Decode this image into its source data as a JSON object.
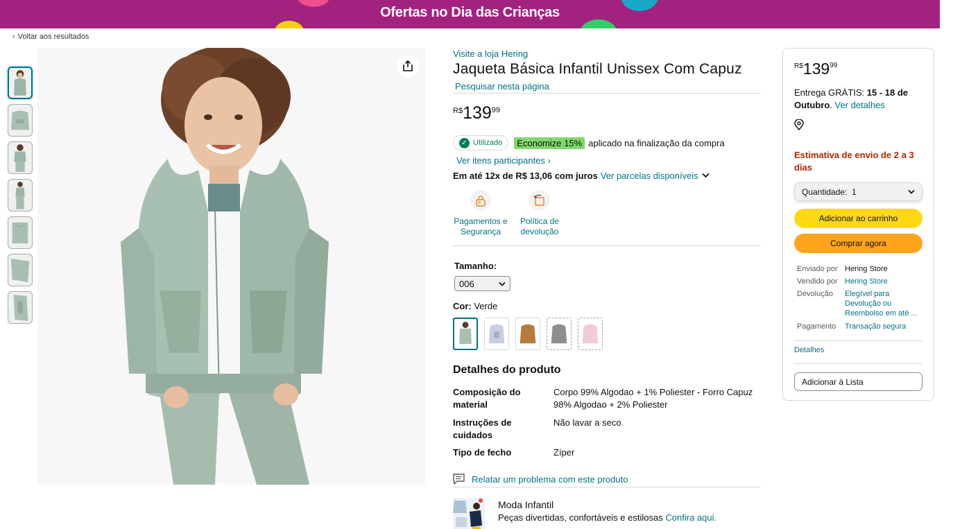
{
  "banner": {
    "title": "Ofertas no Dia das Crianças"
  },
  "nav": {
    "back_label": "Voltar aos resultados"
  },
  "product": {
    "store_link": "Visite a loja Hering",
    "title": "Jaqueta Básica Infantil Unissex Com Capuz",
    "search_page": "Pesquisar nesta página",
    "price": {
      "currency": "R$",
      "whole": "139",
      "fraction": "99"
    },
    "coupon": {
      "used_label": "Utilizado",
      "save_label": "Economize 15%",
      "applied_text": "aplicado na finalização da compra",
      "participating_link": "Ver itens participantes ›"
    },
    "installments": {
      "text": "Em até 12x de R$ 13,06 com juros",
      "link": "Ver parcelas disponíveis"
    },
    "features": [
      {
        "icon": "payment-lock-icon",
        "label1": "Pagamentos e",
        "label2": "Segurança"
      },
      {
        "icon": "return-box-icon",
        "label1": "Política de",
        "label2": "devolução"
      }
    ],
    "size": {
      "label": "Tamanho:",
      "value": "006"
    },
    "color": {
      "label": "Cor:",
      "value": "Verde"
    },
    "swatch_colors": [
      "#a9c0b0",
      "#c6d0df",
      "#b47a3e",
      "#8e8f93",
      "#f2c9d6"
    ],
    "details": {
      "title": "Detalhes do produto",
      "rows": [
        {
          "key": "Composição do material",
          "value": "Corpo 99% Algodao + 1% Poliester - Forro Capuz 98% Algodao + 2% Poliester"
        },
        {
          "key": "Instruções de cuidados",
          "value": "Não lavar a seco"
        },
        {
          "key": "Tipo de fecho",
          "value": "Zíper"
        }
      ]
    },
    "report_link": "Relatar um problema com este produto",
    "promo": {
      "title": "Moda Infantil",
      "subtitle": "Peças divertidas, confortáveis e estilosas",
      "link": "Confira aqui."
    }
  },
  "buybox": {
    "price": {
      "currency": "R$",
      "whole": "139",
      "fraction": "99"
    },
    "delivery_prefix": "Entrega GRÁTIS:",
    "delivery_dates": "15 - 18 de Outubro",
    "delivery_link": "Ver detalhes",
    "estimate": "Estimativa de envio de 2 a 3 dias",
    "quantity": "Quantidade:  1",
    "add_to_cart": "Adicionar ao carrinho",
    "buy_now": "Comprar agora",
    "shipped_by_label": "Enviado por",
    "shipped_by_value": "Hering Store",
    "sold_by_label": "Vendido por",
    "sold_by_value": "Hering Store",
    "return_label": "Devolução",
    "return_value": "Elegível para Devolução ou Reembolso em até ...",
    "payment_label": "Pagamento",
    "payment_value": "Transação segura",
    "details_link": "Detalhes",
    "add_to_list": "Adicionar à Lista"
  },
  "colors": {
    "link": "#007185",
    "banner": "#a2227f",
    "cart": "#ffd814",
    "buy": "#ffa41c",
    "price_alert": "#b12704",
    "save_tag": "#7fda69"
  }
}
